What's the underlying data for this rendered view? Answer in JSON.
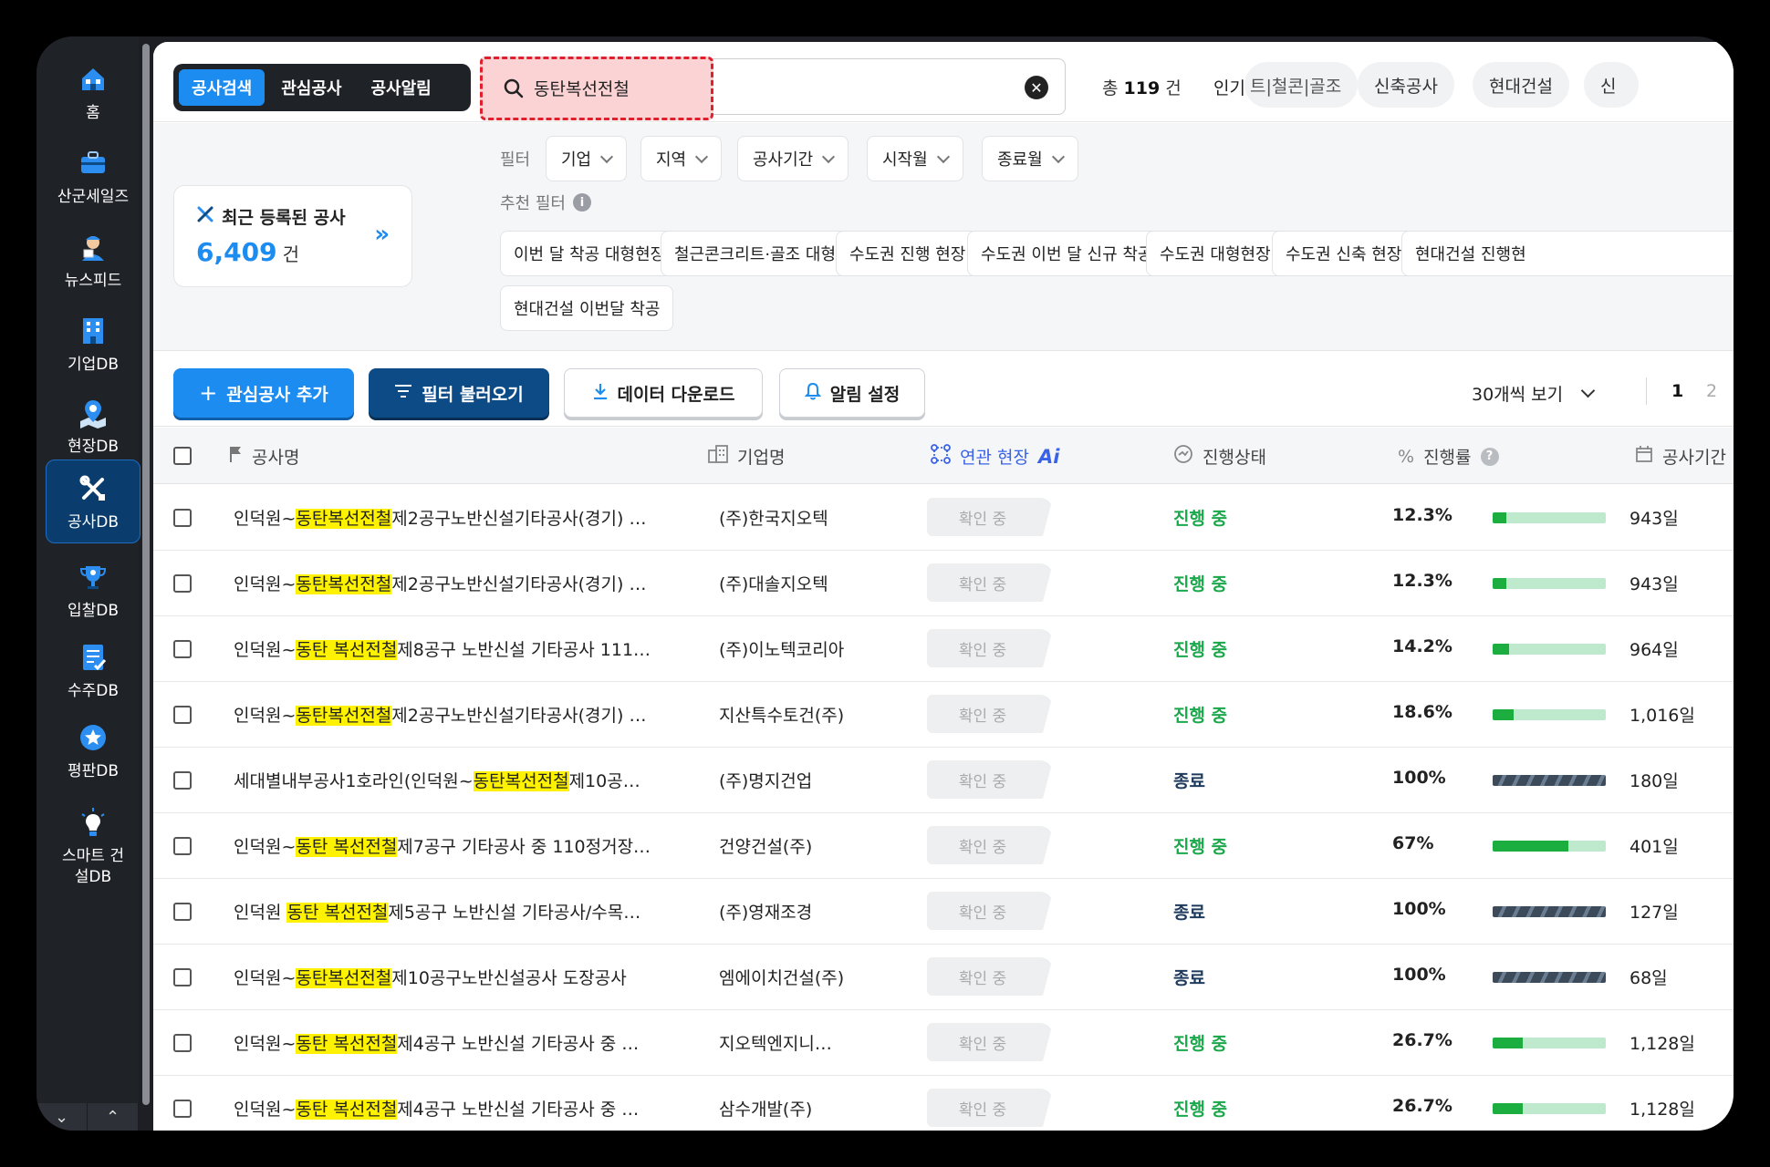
{
  "sidebar": {
    "items": [
      {
        "label": "홈",
        "icon": "home-icon"
      },
      {
        "label": "산군세일즈",
        "icon": "briefcase-icon"
      },
      {
        "label": "뉴스피드",
        "icon": "news-reporter-icon"
      },
      {
        "label": "기업DB",
        "icon": "building-icon"
      },
      {
        "label": "현장DB",
        "icon": "map-pin-icon"
      },
      {
        "label": "공사DB",
        "icon": "tools-icon"
      },
      {
        "label": "입찰DB",
        "icon": "trophy-icon"
      },
      {
        "label": "수주DB",
        "icon": "document-icon"
      },
      {
        "label": "평판DB",
        "icon": "star-badge-icon"
      },
      {
        "label": "스마트 건설DB",
        "icon": "lightbulb-icon"
      }
    ],
    "active_index": 5
  },
  "top": {
    "tabs": [
      "공사검색",
      "관심공사",
      "공사알림"
    ],
    "active_tab": 0,
    "search_value": "동탄복선전철",
    "total_prefix": "총",
    "total_count": "119",
    "total_unit": "건",
    "popular_label": "인기 검색어",
    "popular_chips": [
      "트|철콘|골조",
      "신축공사",
      "현대건설",
      "신"
    ]
  },
  "filters": {
    "label": "필터",
    "buttons": [
      "기업",
      "지역",
      "공사기간",
      "시작월",
      "종료월"
    ],
    "recommend_label": "추천 필터",
    "recommend": [
      "이번 달 착공 대형현장",
      "철근콘크리트·골조 대형",
      "수도권 진행 현장",
      "수도권 이번 달 신규 착공",
      "수도권 대형현장",
      "수도권 신축 현장",
      "현대건설 진행현",
      "현대건설 이번달 착공"
    ]
  },
  "recent": {
    "title": "최근 등록된 공사",
    "count": "6,409",
    "unit": "건"
  },
  "actions": {
    "add_interest": "관심공사 추가",
    "load_filter": "필터 불러오기",
    "download": "데이터 다운로드",
    "alert": "알림 설정",
    "per_page": "30개씩 보기",
    "pages": [
      "1",
      "2"
    ]
  },
  "table": {
    "headers": {
      "name": "공사명",
      "company": "기업명",
      "related": "연관 현장",
      "related_ai": "Ai",
      "status": "진행상태",
      "rate": "진행률",
      "period": "공사기간"
    },
    "rows": [
      {
        "pre": "인덕원~",
        "hl": "동탄복선전철",
        "post": "제2공구노반신설기타공사(경기) …",
        "company": "(주)한국지오텍",
        "related": "확인 중",
        "status": "진행 중",
        "state": "ongoing",
        "rate": "12.3%",
        "progress": 0.123,
        "period": "943일"
      },
      {
        "pre": "인덕원~",
        "hl": "동탄복선전철",
        "post": "제2공구노반신설기타공사(경기) …",
        "company": "(주)대솔지오텍",
        "related": "확인 중",
        "status": "진행 중",
        "state": "ongoing",
        "rate": "12.3%",
        "progress": 0.123,
        "period": "943일"
      },
      {
        "pre": "인덕원~",
        "hl": "동탄 복선전철",
        "post": "제8공구 노반신설 기타공사 111…",
        "company": "(주)이노텍코리아",
        "related": "확인 중",
        "status": "진행 중",
        "state": "ongoing",
        "rate": "14.2%",
        "progress": 0.142,
        "period": "964일"
      },
      {
        "pre": "인덕원~",
        "hl": "동탄복선전철",
        "post": "제2공구노반신설기타공사(경기) …",
        "company": "지산특수토건(주)",
        "related": "확인 중",
        "status": "진행 중",
        "state": "ongoing",
        "rate": "18.6%",
        "progress": 0.186,
        "period": "1,016일"
      },
      {
        "pre": "세대별내부공사1호라인(인덕원~",
        "hl": "동탄복선전철",
        "post": "제10공…",
        "company": "(주)명지건업",
        "related": "확인 중",
        "status": "종료",
        "state": "done",
        "rate": "100%",
        "progress": 1.0,
        "period": "180일"
      },
      {
        "pre": "인덕원~",
        "hl": "동탄 복선전철",
        "post": "제7공구 기타공사 중 110정거장…",
        "company": "건양건설(주)",
        "related": "확인 중",
        "status": "진행 중",
        "state": "ongoing",
        "rate": "67%",
        "progress": 0.67,
        "period": "401일"
      },
      {
        "pre": "인덕원 ",
        "hl": "동탄 복선전철",
        "post": "제5공구 노반신설 기타공사/수목…",
        "company": "(주)영재조경",
        "related": "확인 중",
        "status": "종료",
        "state": "done",
        "rate": "100%",
        "progress": 1.0,
        "period": "127일"
      },
      {
        "pre": "인덕원~",
        "hl": "동탄복선전철",
        "post": "제10공구노반신설공사 도장공사",
        "company": "엠에이치건설(주)",
        "related": "확인 중",
        "status": "종료",
        "state": "done",
        "rate": "100%",
        "progress": 1.0,
        "period": "68일"
      },
      {
        "pre": "인덕원~",
        "hl": "동탄 복선전철",
        "post": "제4공구 노반신설 기타공사 중 …",
        "company": "지오텍엔지니…",
        "related": "확인 중",
        "status": "진행 중",
        "state": "ongoing",
        "rate": "26.7%",
        "progress": 0.267,
        "period": "1,128일"
      },
      {
        "pre": "인덕원~",
        "hl": "동탄 복선전철",
        "post": "제4공구 노반신설 기타공사 중 …",
        "company": "삼수개발(주)",
        "related": "확인 중",
        "status": "진행 중",
        "state": "ongoing",
        "rate": "26.7%",
        "progress": 0.267,
        "period": "1,128일"
      }
    ]
  }
}
